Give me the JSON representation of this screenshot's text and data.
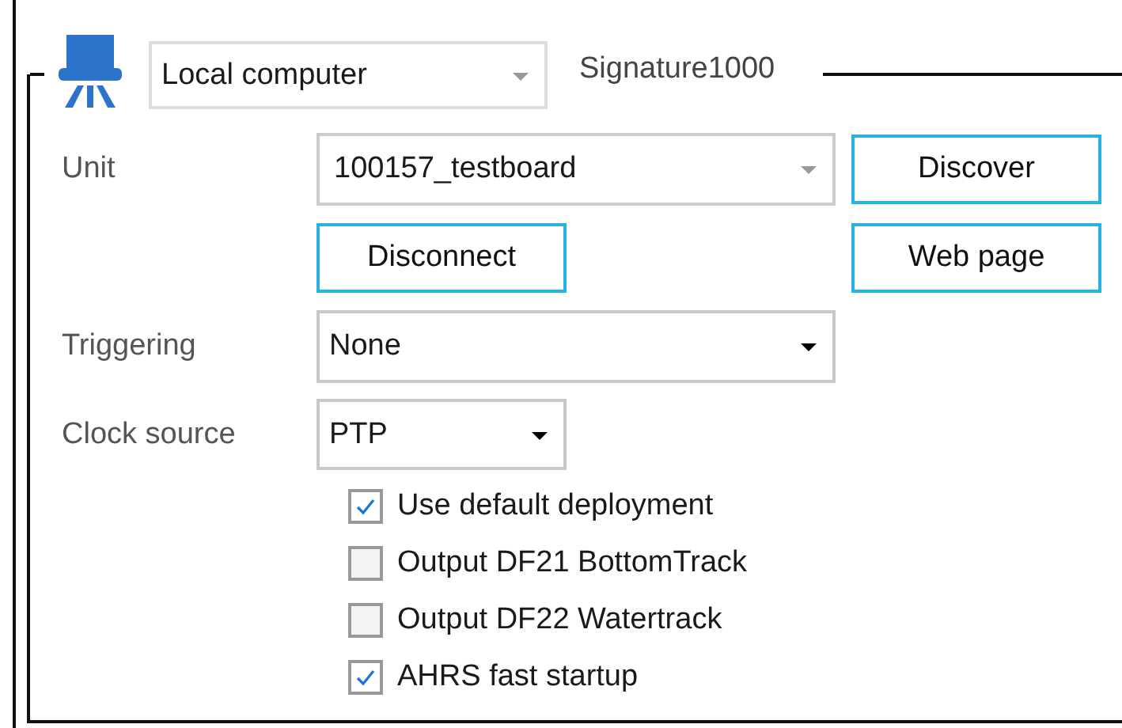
{
  "connection": {
    "source": "Local computer",
    "device": "Signature1000"
  },
  "unit": {
    "label": "Unit",
    "value": "100157_testboard",
    "discover_button": "Discover",
    "disconnect_button": "Disconnect",
    "web_page_button": "Web page"
  },
  "triggering": {
    "label": "Triggering",
    "value": "None"
  },
  "clock_source": {
    "label": "Clock source",
    "value": "PTP"
  },
  "options": [
    {
      "label": "Use default deployment",
      "checked": true
    },
    {
      "label": "Output DF21 BottomTrack",
      "checked": false
    },
    {
      "label": "Output DF22 Watertrack",
      "checked": false
    },
    {
      "label": "AHRS fast startup",
      "checked": true
    }
  ]
}
